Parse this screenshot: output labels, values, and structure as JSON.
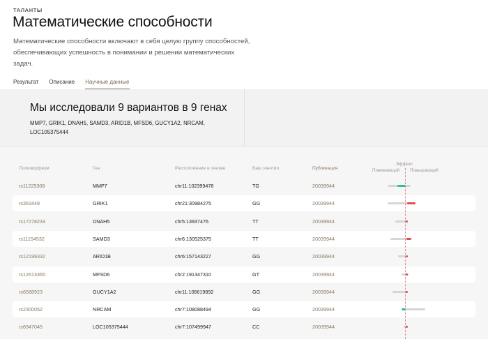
{
  "header": {
    "kicker": "ТАЛАНТЫ",
    "title": "Математические способности",
    "description": "Математические способности включают в себя целую группу способностей, обеспечивающих успешность в понимании и решении математических задач."
  },
  "tabs": [
    {
      "label": "Результат",
      "active": false
    },
    {
      "label": "Описание",
      "active": false
    },
    {
      "label": "Научные данные",
      "active": true
    }
  ],
  "summary": {
    "title": "Мы исследовали 9 вариантов в 9 генах",
    "genes": "MMP7, GRIK1, DNAH5, SAMD3, ARID1B, MFSD6, GUCY1A2, NRCAM, LOC105375444"
  },
  "table": {
    "headers": {
      "polymorphism": "Полиморфизм",
      "gene": "Ген",
      "location": "Расположение в геноме",
      "genotype": "Ваш генотип",
      "publication": "Публикация",
      "effect": "Эффект",
      "effect_lowering": "Понижающий",
      "effect_raising": "Повышающий"
    },
    "rows": [
      {
        "rs": "rs11225308",
        "gene": "MMP7",
        "location": "chr11:102399478",
        "genotype": "TG",
        "publication": "20039944"
      },
      {
        "rs": "rs363449",
        "gene": "GRIK1",
        "location": "chr21:30984275",
        "genotype": "GG",
        "publication": "20039944"
      },
      {
        "rs": "rs17278234",
        "gene": "DNAH5",
        "location": "chr5:13937476",
        "genotype": "TT",
        "publication": "20039944"
      },
      {
        "rs": "rs11154532",
        "gene": "SAMD3",
        "location": "chr6:130525375",
        "genotype": "TT",
        "publication": "20039944"
      },
      {
        "rs": "rs12199332",
        "gene": "ARID1B",
        "location": "chr6:157143227",
        "genotype": "GG",
        "publication": "20039944"
      },
      {
        "rs": "rs12613365",
        "gene": "MFSD6",
        "location": "chr2:191347310",
        "genotype": "GT",
        "publication": "20039944"
      },
      {
        "rs": "rs6588923",
        "gene": "GUCY1A2",
        "location": "chr11:106619892",
        "genotype": "GG",
        "publication": "20039944"
      },
      {
        "rs": "rs2300052",
        "gene": "NRCAM",
        "location": "chr7:108088494",
        "genotype": "GG",
        "publication": "20039944"
      },
      {
        "rs": "rs6947045",
        "gene": "LOC105375444",
        "location": "chr7:107499947",
        "genotype": "CC",
        "publication": "20039944"
      }
    ]
  },
  "effects": [
    {
      "range": [
        -0.5,
        0.15
      ],
      "effect": [
        -0.22,
        0.02
      ],
      "direction": "lowering"
    },
    {
      "range": [
        -0.5,
        0.3
      ],
      "effect": [
        0.05,
        0.3
      ],
      "direction": "raising"
    },
    {
      "range": [
        -0.28,
        0.06
      ],
      "effect": [
        0.02,
        0.06
      ],
      "direction": "raising"
    },
    {
      "range": [
        -0.42,
        0.18
      ],
      "effect": [
        0.03,
        0.18
      ],
      "direction": "raising"
    },
    {
      "range": [
        -0.2,
        0.04
      ],
      "effect": [
        0.015,
        0.04
      ],
      "direction": "raising"
    },
    {
      "range": [
        -0.1,
        0.1
      ],
      "effect": [
        0.015,
        0.06
      ],
      "direction": "raising"
    },
    {
      "range": [
        -0.36,
        0.08
      ],
      "effect": [
        0.02,
        0.08
      ],
      "direction": "raising"
    },
    {
      "range": [
        -0.1,
        0.58
      ],
      "effect": [
        -0.1,
        0.02
      ],
      "direction": "lowering"
    },
    {
      "range": [
        -0.05,
        0.04
      ],
      "effect": [
        0.01,
        0.04
      ],
      "direction": "raising"
    }
  ],
  "colors": {
    "accent": "#8a7a62",
    "raising": "#e64c4c",
    "lowering": "#29c39a",
    "range": "#d6d6d6"
  }
}
